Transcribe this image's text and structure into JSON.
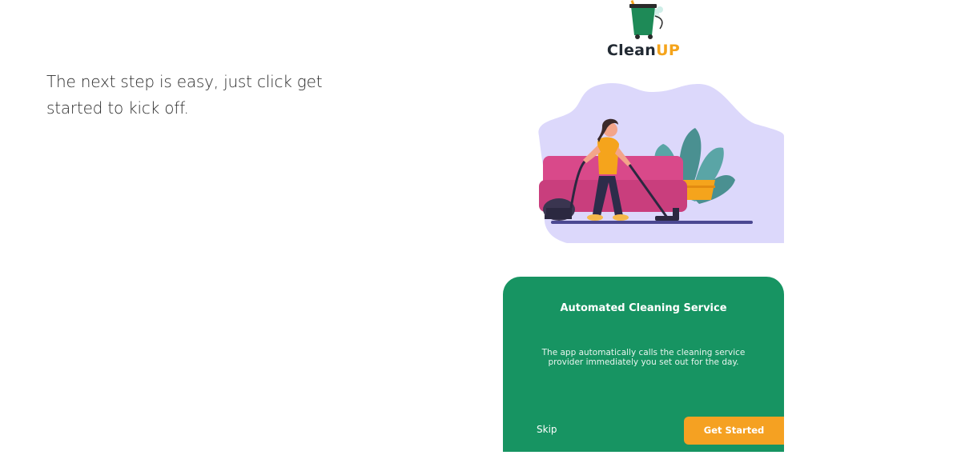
{
  "intro": {
    "text": "The next step is easy, just click get started to kick off."
  },
  "app": {
    "logo": {
      "text_part1": "Clean",
      "text_part2": "UP",
      "icon": "mop-bucket-icon"
    },
    "illustration": {
      "icon": "woman-vacuuming-illustration"
    },
    "card": {
      "title": "Automated Cleaning Service",
      "description": "The app automatically calls the cleaning service provider immediately you set out for the day.",
      "skip_label": "Skip",
      "get_started_label": "Get Started"
    }
  },
  "colors": {
    "card_green": "#179462",
    "accent_orange": "#f5a122",
    "logo_dark": "#222a33",
    "blob_lavender": "#dcd8fb",
    "sofa_pink": "#d9498a"
  }
}
